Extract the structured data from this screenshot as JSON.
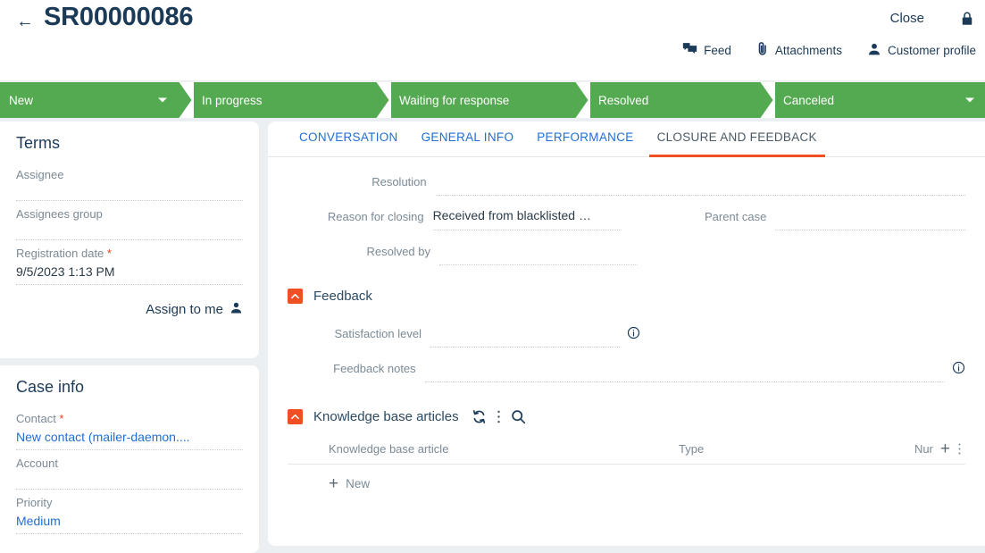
{
  "header": {
    "back_icon": "arrow-left-icon",
    "title": "SR00000086",
    "close_label": "Close",
    "lock_icon": "lock-icon",
    "quick_actions": [
      {
        "label": "Feed",
        "icon": "feed-icon"
      },
      {
        "label": "Attachments",
        "icon": "paperclip-icon"
      },
      {
        "label": "Customer profile",
        "icon": "person-icon"
      }
    ]
  },
  "stage_bar": {
    "color": "#54aa50",
    "stages": [
      {
        "label": "New",
        "has_caret": true
      },
      {
        "label": "In progress",
        "has_caret": false
      },
      {
        "label": "Waiting for response",
        "has_caret": false
      },
      {
        "label": "Resolved",
        "has_caret": false
      },
      {
        "label": "Canceled",
        "has_caret": true
      }
    ]
  },
  "sidebar": {
    "terms": {
      "title": "Terms",
      "fields": [
        {
          "label": "Assignee",
          "value": "",
          "required": false
        },
        {
          "label": "Assignees group",
          "value": "",
          "required": false
        },
        {
          "label": "Registration date",
          "value": "9/5/2023 1:13 PM",
          "required": true
        }
      ],
      "assign_to_me_label": "Assign to me",
      "assign_to_me_icon": "person-icon"
    },
    "case_info": {
      "title": "Case info",
      "fields": [
        {
          "label": "Contact",
          "value": "New contact (mailer-daemon....",
          "required": true,
          "link": true
        },
        {
          "label": "Account",
          "value": "",
          "required": false,
          "link": false
        },
        {
          "label": "Priority",
          "value": "Medium",
          "required": false,
          "link": true
        }
      ]
    }
  },
  "main": {
    "tabs": [
      {
        "label": "CONVERSATION",
        "active": false
      },
      {
        "label": "GENERAL INFO",
        "active": false
      },
      {
        "label": "PERFORMANCE",
        "active": false
      },
      {
        "label": "CLOSURE AND FEEDBACK",
        "active": true
      }
    ],
    "closure": {
      "resolution": {
        "label": "Resolution",
        "value": ""
      },
      "reason_for_closing": {
        "label": "Reason for closing",
        "value": "Received from blacklisted …"
      },
      "parent_case": {
        "label": "Parent case",
        "value": ""
      },
      "resolved_by": {
        "label": "Resolved by",
        "value": ""
      }
    },
    "feedback": {
      "title": "Feedback",
      "collapse_icon": "chevron-up-icon",
      "satisfaction_level": {
        "label": "Satisfaction level",
        "value": "",
        "info_icon": "info-icon"
      },
      "feedback_notes": {
        "label": "Feedback notes",
        "value": "",
        "info_icon": "info-icon"
      }
    },
    "knowledge_base": {
      "title": "Knowledge base articles",
      "collapse_icon": "chevron-up-icon",
      "icons": [
        {
          "name": "refresh-icon"
        },
        {
          "name": "more-vertical-icon"
        },
        {
          "name": "search-icon"
        }
      ],
      "columns": [
        "Knowledge base article",
        "Type",
        "Nur"
      ],
      "rows": [],
      "add_column_icon": "plus-icon",
      "column_menu_icon": "more-vertical-icon",
      "new_row_label": "New",
      "new_row_icon": "plus-icon"
    }
  },
  "colors": {
    "accent": "#f04e23",
    "link": "#1f6fd4",
    "stage_green": "#54aa50",
    "title": "#1b3a57",
    "required": "#e8431f"
  }
}
